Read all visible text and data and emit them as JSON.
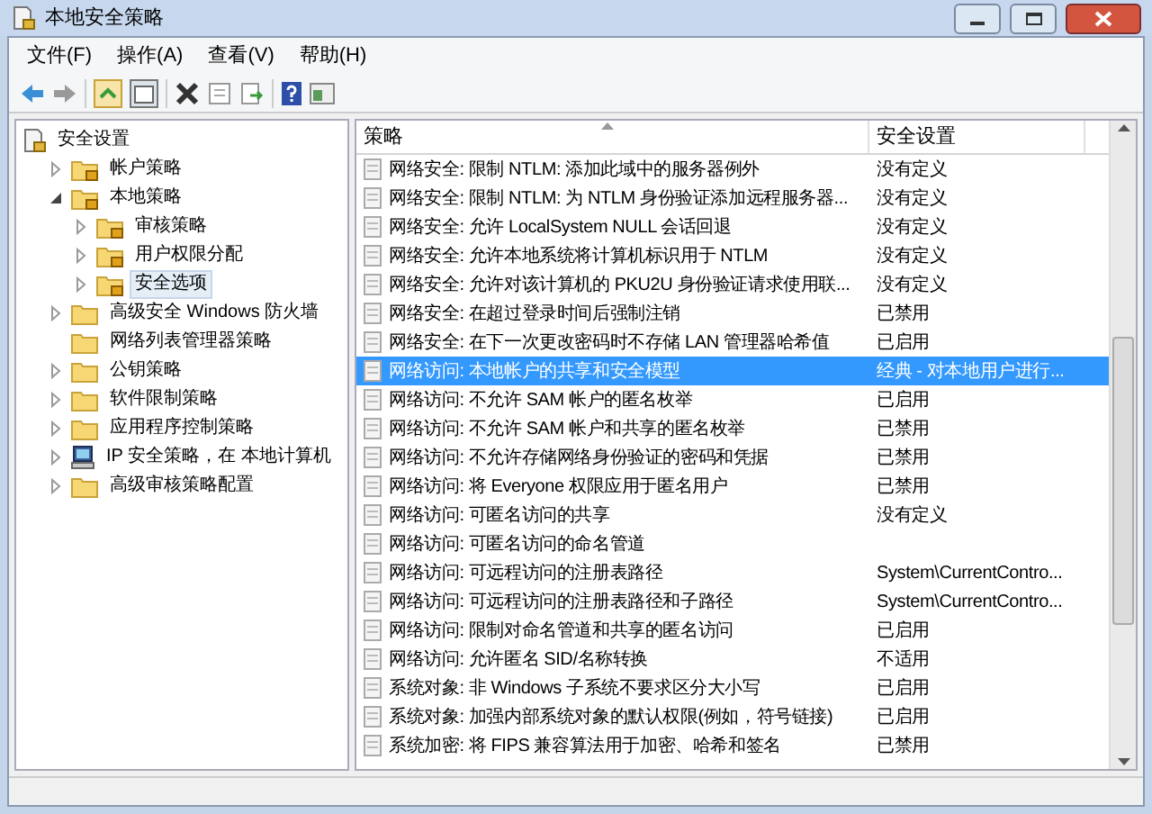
{
  "window": {
    "title": "本地安全策略"
  },
  "menu": [
    "文件(F)",
    "操作(A)",
    "查看(V)",
    "帮助(H)"
  ],
  "tree": {
    "label": "安全设置",
    "kind": "root",
    "children": [
      {
        "label": "帐户策略",
        "kind": "secured_folder",
        "expandable": true,
        "expanded": false,
        "selected": false
      },
      {
        "label": "本地策略",
        "kind": "secured_folder",
        "expandable": true,
        "expanded": true,
        "selected": false,
        "children": [
          {
            "label": "审核策略",
            "kind": "secured_folder",
            "expandable": true,
            "expanded": false,
            "selected": false
          },
          {
            "label": "用户权限分配",
            "kind": "secured_folder",
            "expandable": true,
            "expanded": false,
            "selected": false
          },
          {
            "label": "安全选项",
            "kind": "secured_folder",
            "expandable": true,
            "expanded": false,
            "selected": true
          }
        ]
      },
      {
        "label": "高级安全 Windows 防火墙",
        "kind": "folder",
        "expandable": true,
        "expanded": false,
        "selected": false
      },
      {
        "label": "网络列表管理器策略",
        "kind": "folder",
        "expandable": false,
        "selected": false
      },
      {
        "label": "公钥策略",
        "kind": "folder",
        "expandable": true,
        "expanded": false,
        "selected": false
      },
      {
        "label": "软件限制策略",
        "kind": "folder",
        "expandable": true,
        "expanded": false,
        "selected": false
      },
      {
        "label": "应用程序控制策略",
        "kind": "folder",
        "expandable": true,
        "expanded": false,
        "selected": false
      },
      {
        "label": "IP 安全策略，在 本地计算机",
        "kind": "ip_policy",
        "expandable": true,
        "expanded": false,
        "selected": false
      },
      {
        "label": "高级审核策略配置",
        "kind": "folder",
        "expandable": true,
        "expanded": false,
        "selected": false
      }
    ]
  },
  "table": {
    "columns": [
      "策略",
      "安全设置"
    ],
    "rows": [
      {
        "policy": "网络安全: 限制 NTLM: 添加此域中的服务器例外",
        "setting": "没有定义",
        "selected": false
      },
      {
        "policy": "网络安全: 限制 NTLM: 为 NTLM 身份验证添加远程服务器...",
        "setting": "没有定义",
        "selected": false
      },
      {
        "policy": "网络安全: 允许 LocalSystem NULL 会话回退",
        "setting": "没有定义",
        "selected": false
      },
      {
        "policy": "网络安全: 允许本地系统将计算机标识用于 NTLM",
        "setting": "没有定义",
        "selected": false
      },
      {
        "policy": "网络安全: 允许对该计算机的 PKU2U 身份验证请求使用联...",
        "setting": "没有定义",
        "selected": false
      },
      {
        "policy": "网络安全: 在超过登录时间后强制注销",
        "setting": "已禁用",
        "selected": false
      },
      {
        "policy": "网络安全: 在下一次更改密码时不存储 LAN 管理器哈希值",
        "setting": "已启用",
        "selected": false
      },
      {
        "policy": "网络访问: 本地帐户的共享和安全模型",
        "setting": "经典 - 对本地用户进行...",
        "selected": true
      },
      {
        "policy": "网络访问: 不允许 SAM 帐户的匿名枚举",
        "setting": "已启用",
        "selected": false
      },
      {
        "policy": "网络访问: 不允许 SAM 帐户和共享的匿名枚举",
        "setting": "已禁用",
        "selected": false
      },
      {
        "policy": "网络访问: 不允许存储网络身份验证的密码和凭据",
        "setting": "已禁用",
        "selected": false
      },
      {
        "policy": "网络访问: 将 Everyone 权限应用于匿名用户",
        "setting": "已禁用",
        "selected": false
      },
      {
        "policy": "网络访问: 可匿名访问的共享",
        "setting": "没有定义",
        "selected": false
      },
      {
        "policy": "网络访问: 可匿名访问的命名管道",
        "selected": false
      },
      {
        "policy": "网络访问: 可远程访问的注册表路径",
        "setting": "System\\CurrentContro...",
        "selected": false
      },
      {
        "policy": "网络访问: 可远程访问的注册表路径和子路径",
        "setting": "System\\CurrentContro...",
        "selected": false
      },
      {
        "policy": "网络访问: 限制对命名管道和共享的匿名访问",
        "setting": "已启用",
        "selected": false
      },
      {
        "policy": "网络访问: 允许匿名 SID/名称转换",
        "setting": "不适用",
        "selected": false
      },
      {
        "policy": "系统对象: 非 Windows 子系统不要求区分大小写",
        "setting": "已启用",
        "selected": false
      },
      {
        "policy": "系统对象: 加强内部系统对象的默认权限(例如，符号链接)",
        "setting": "已启用",
        "selected": false
      },
      {
        "policy": "系统加密: 将 FIPS 兼容算法用于加密、哈希和签名",
        "setting": "已禁用",
        "selected": false
      }
    ]
  }
}
